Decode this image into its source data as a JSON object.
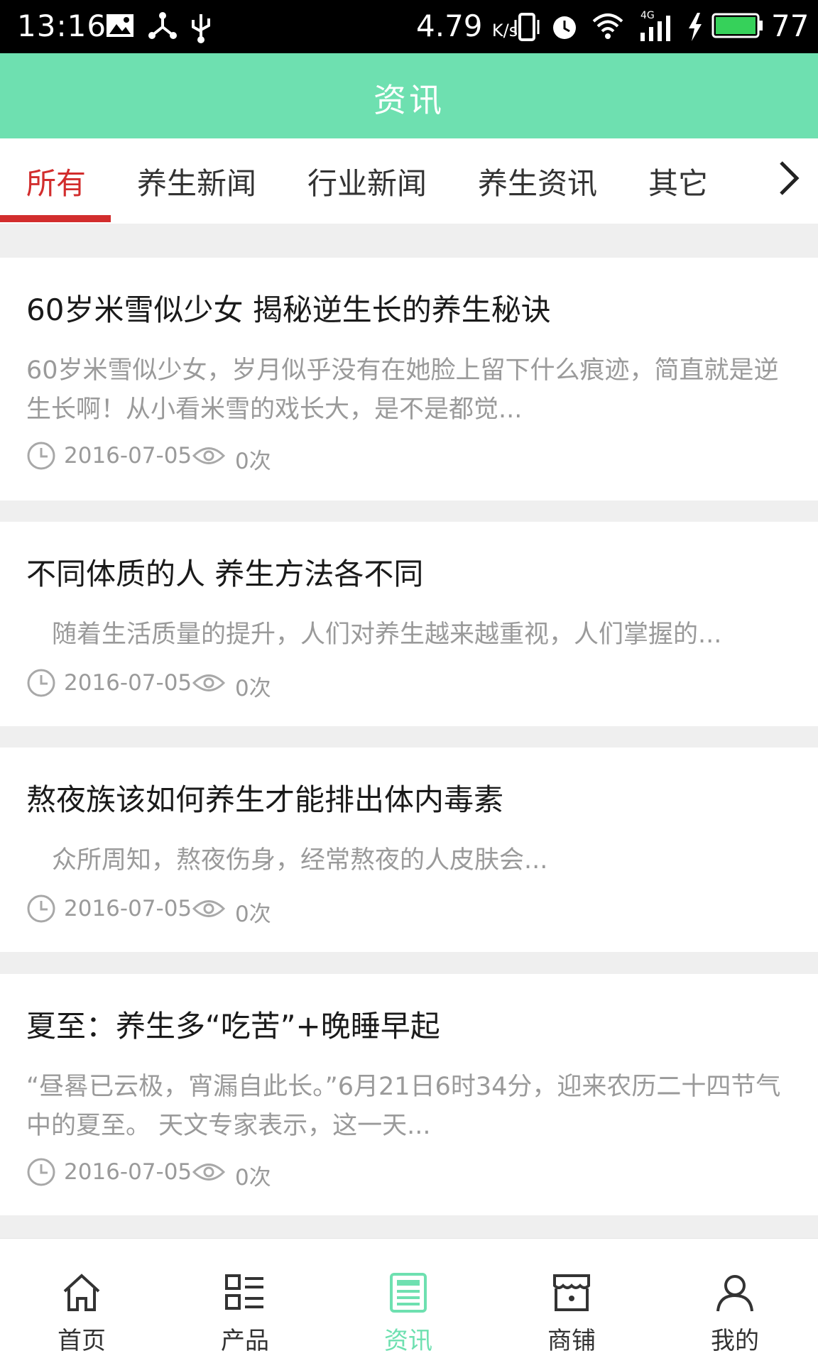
{
  "status_bar": {
    "time": "13:16",
    "net_speed": "4.79",
    "net_unit": "K/s",
    "network_type": "4G",
    "battery": "77"
  },
  "header": {
    "title": "资讯"
  },
  "tabs": [
    {
      "label": "所有",
      "active": true
    },
    {
      "label": "养生新闻",
      "active": false
    },
    {
      "label": "行业新闻",
      "active": false
    },
    {
      "label": "养生资讯",
      "active": false
    },
    {
      "label": "其它",
      "active": false
    }
  ],
  "articles": [
    {
      "title": "60岁米雪似少女 揭秘逆生长的养生秘诀",
      "desc": "60岁米雪似少女，岁月似乎没有在她脸上留下什么痕迹，简直就是逆生长啊！从小看米雪的戏长大，是不是都觉...",
      "date": "2016-07-05",
      "views": "0次"
    },
    {
      "title": "不同体质的人 养生方法各不同",
      "desc": "随着生活质量的提升，人们对养生越来越重视，人们掌握的...",
      "date": "2016-07-05",
      "views": "0次"
    },
    {
      "title": "熬夜族该如何养生才能排出体内毒素",
      "desc": "众所周知，熬夜伤身，经常熬夜的人皮肤会...",
      "date": "2016-07-05",
      "views": "0次"
    },
    {
      "title": "夏至：养生多“吃苦”+晚睡早起",
      "desc": "“昼晷已云极，宵漏自此长。”6月21日6时34分，迎来农历二十四节气中的夏至。 天文专家表示，这一天...",
      "date": "2016-07-05",
      "views": "0次"
    }
  ],
  "bottom_nav": [
    {
      "label": "首页",
      "icon": "home-icon"
    },
    {
      "label": "产品",
      "icon": "product-grid-icon"
    },
    {
      "label": "资讯",
      "icon": "news-icon",
      "active": true
    },
    {
      "label": "商铺",
      "icon": "shop-icon"
    },
    {
      "label": "我的",
      "icon": "user-icon"
    }
  ],
  "colors": {
    "accent": "#6ee0b0",
    "tab_active": "#d22d2d",
    "muted_text": "#9a9a9a"
  }
}
